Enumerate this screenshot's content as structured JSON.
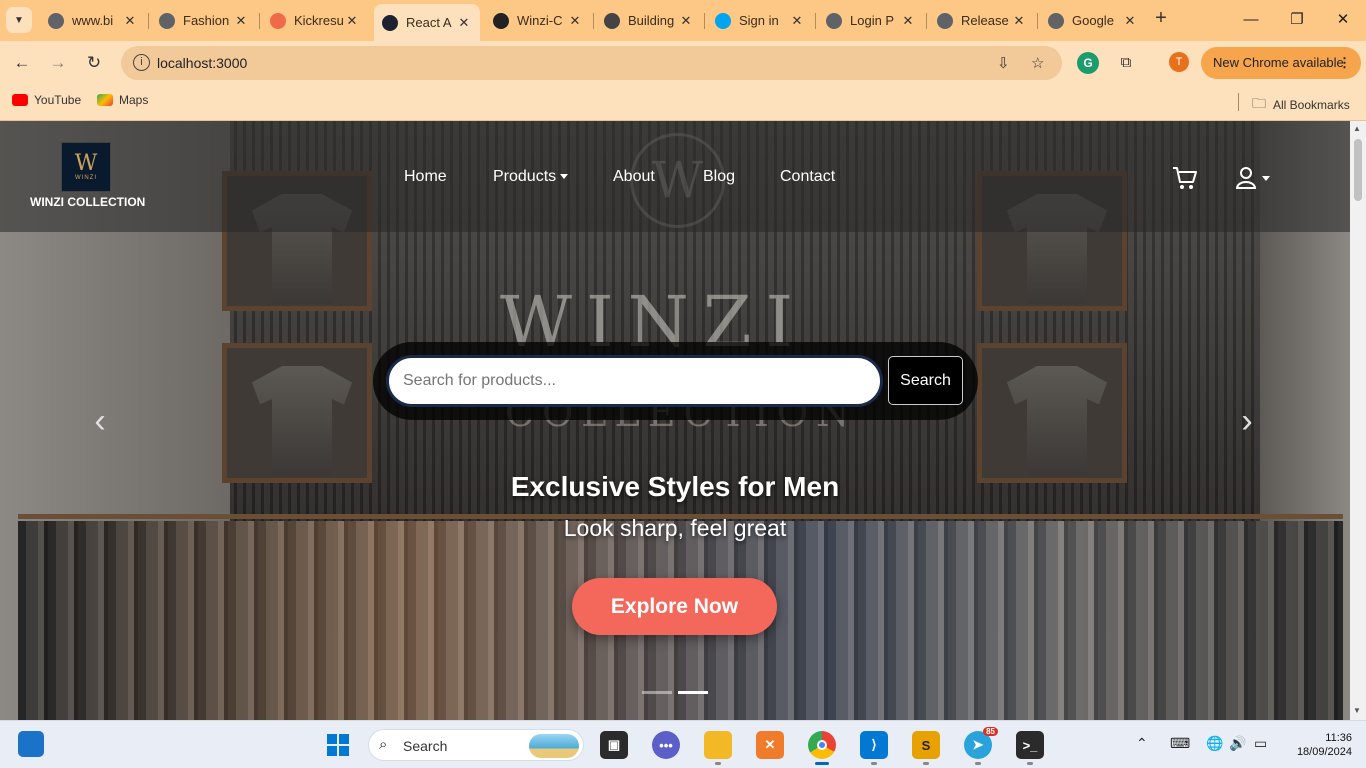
{
  "browser": {
    "tabs": [
      {
        "label": "www.bi",
        "color": "#5f6368"
      },
      {
        "label": "Fashion",
        "color": "#5f6368"
      },
      {
        "label": "Kickresu",
        "color": "#f06a4a"
      },
      {
        "label": "React A",
        "color": "#1d2230",
        "active": true
      },
      {
        "label": "Winzi-C",
        "color": "#222222"
      },
      {
        "label": "Building",
        "color": "#444444"
      },
      {
        "label": "Sign in",
        "color": "#00a4ef"
      },
      {
        "label": "Login P",
        "color": "#5f6368"
      },
      {
        "label": "Release",
        "color": "#5f6368"
      },
      {
        "label": "Google",
        "color": "#5f6368"
      }
    ],
    "url": "localhost:3000",
    "profile_initial": "T",
    "update_label": "New Chrome available",
    "bookmarks": [
      {
        "label": "YouTube",
        "color": "#ff0000"
      },
      {
        "label": "Maps",
        "color": "#34a853"
      }
    ],
    "all_bookmarks": "All Bookmarks"
  },
  "site": {
    "logo_mark": "W",
    "logo_text": "WINZI",
    "brand": "WINZI COLLECTION",
    "nav": [
      "Home",
      "Products",
      "About",
      "Blog",
      "Contact"
    ],
    "search": {
      "placeholder": "Search for products...",
      "button": "Search"
    },
    "hero": {
      "title": "Exclusive Styles for Men",
      "subtitle": "Look sharp, feel great",
      "cta": "Explore Now",
      "slide_count": 2,
      "active_slide": 2
    },
    "accent_color": "#f4685c"
  },
  "taskbar": {
    "search_label": "Search",
    "telegram_badge": "85",
    "time": "11:36",
    "date": "18/09/2024"
  }
}
